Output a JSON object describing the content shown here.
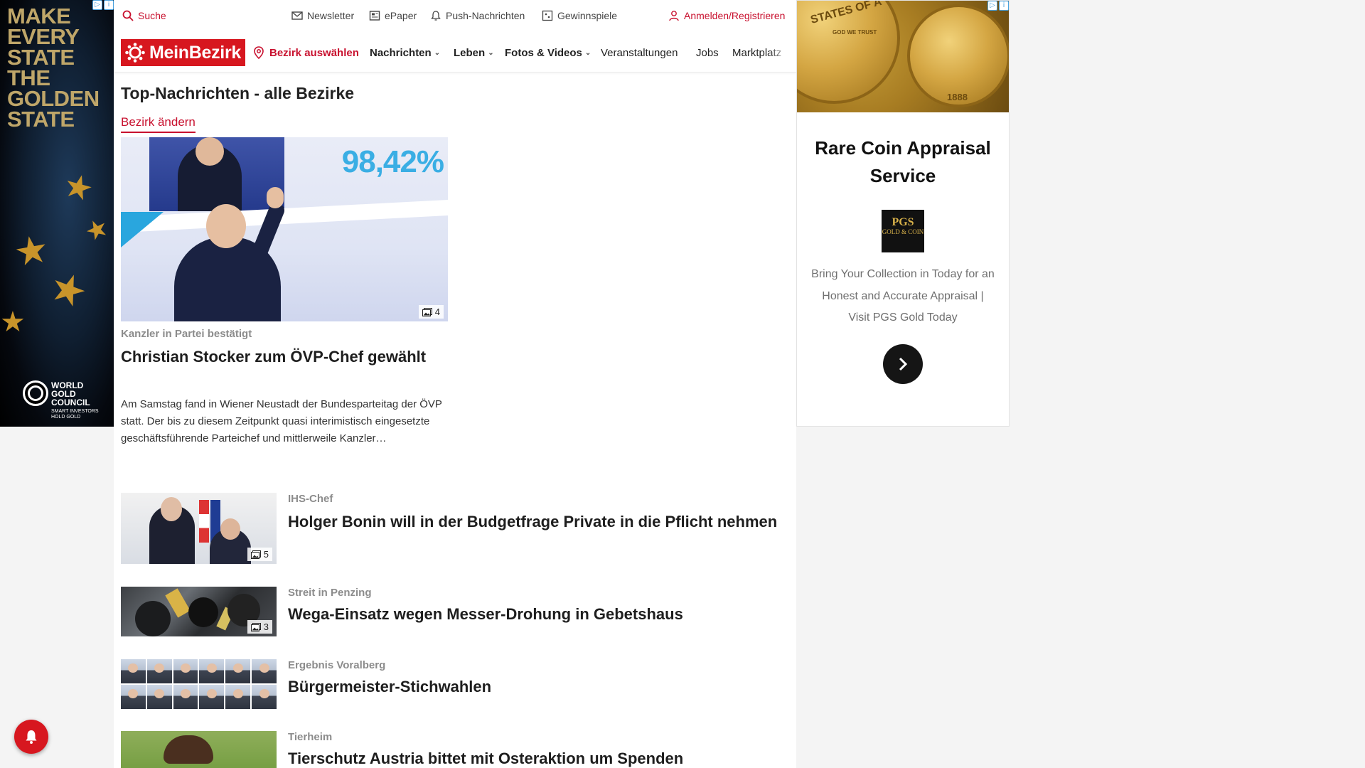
{
  "left_ad": {
    "headline": "MAKE\nEVERY\nSTATE\nTHE\nGOLDEN\nSTATE",
    "brand": "WORLD\nGOLD\nCOUNCIL",
    "tagline": "SMART INVESTORS\nHOLD GOLD",
    "adchoices_icon": "adchoices-icon",
    "info_icon": "info-icon"
  },
  "topbar": {
    "search": "Suche",
    "newsletter": "Newsletter",
    "epaper": "ePaper",
    "push": "Push-Nachrichten",
    "gewinnspiele": "Gewinnspiele",
    "login": "Anmelden/Registrieren"
  },
  "navbar": {
    "logo": "MeinBezirk",
    "bezirk": "Bezirk auswählen",
    "items": [
      {
        "label": "Nachrichten",
        "dropdown": true
      },
      {
        "label": "Leben",
        "dropdown": true
      },
      {
        "label": "Fotos & Videos",
        "dropdown": true
      },
      {
        "label": "Veranstaltungen",
        "dropdown": false
      },
      {
        "label": "Jobs",
        "dropdown": false
      },
      {
        "label": "Marktplatz",
        "dropdown": false
      }
    ]
  },
  "main": {
    "title": "Top-Nachrichten - alle Bezirke",
    "change_district": "Bezirk ändern",
    "lead": {
      "overlay_text": "98,42%",
      "image_count": "4",
      "kicker": "Kanzler in Partei bestätigt",
      "headline": "Christian Stocker zum ÖVP-Chef gewählt",
      "teaser": "Am Samstag fand in Wiener Neustadt der Bundesparteitag der ÖVP statt. Der bis zu diesem Zeitpunkt quasi interimistisch eingesetzte geschäftsführende Parteichef und mittlerweile Kanzler…"
    },
    "articles": [
      {
        "kicker": "IHS-Chef",
        "headline": "Holger Bonin will in der Budgetfrage Private in die Pflicht nehmen",
        "image_count": "5"
      },
      {
        "kicker": "Streit in Penzing",
        "headline": "Wega-Einsatz wegen Messer-Drohung in Gebetshaus",
        "image_count": "3"
      },
      {
        "kicker": "Ergebnis Voralberg",
        "headline": "Bürgermeister-Stichwahlen",
        "image_count": ""
      },
      {
        "kicker": "Tierheim",
        "headline": "Tierschutz Austria bittet mit Osteraktion um Spenden",
        "image_count": ""
      }
    ]
  },
  "right_ad": {
    "coin_text_left": "STATES OF A",
    "coin_text_god": "GOD WE TRUST",
    "coin_year": "1888",
    "title": "Rare Coin Appraisal Service",
    "logo_line1": "PGS",
    "logo_line2": "GOLD & COIN",
    "description": "Bring Your Collection in Today for an Honest and Accurate Appraisal | Visit PGS Gold Today",
    "cta_icon": "chevron-right-icon"
  },
  "colors": {
    "brand_red": "#d7171f",
    "link_red": "#c8102e",
    "kicker_gray": "#8c8c8c"
  }
}
